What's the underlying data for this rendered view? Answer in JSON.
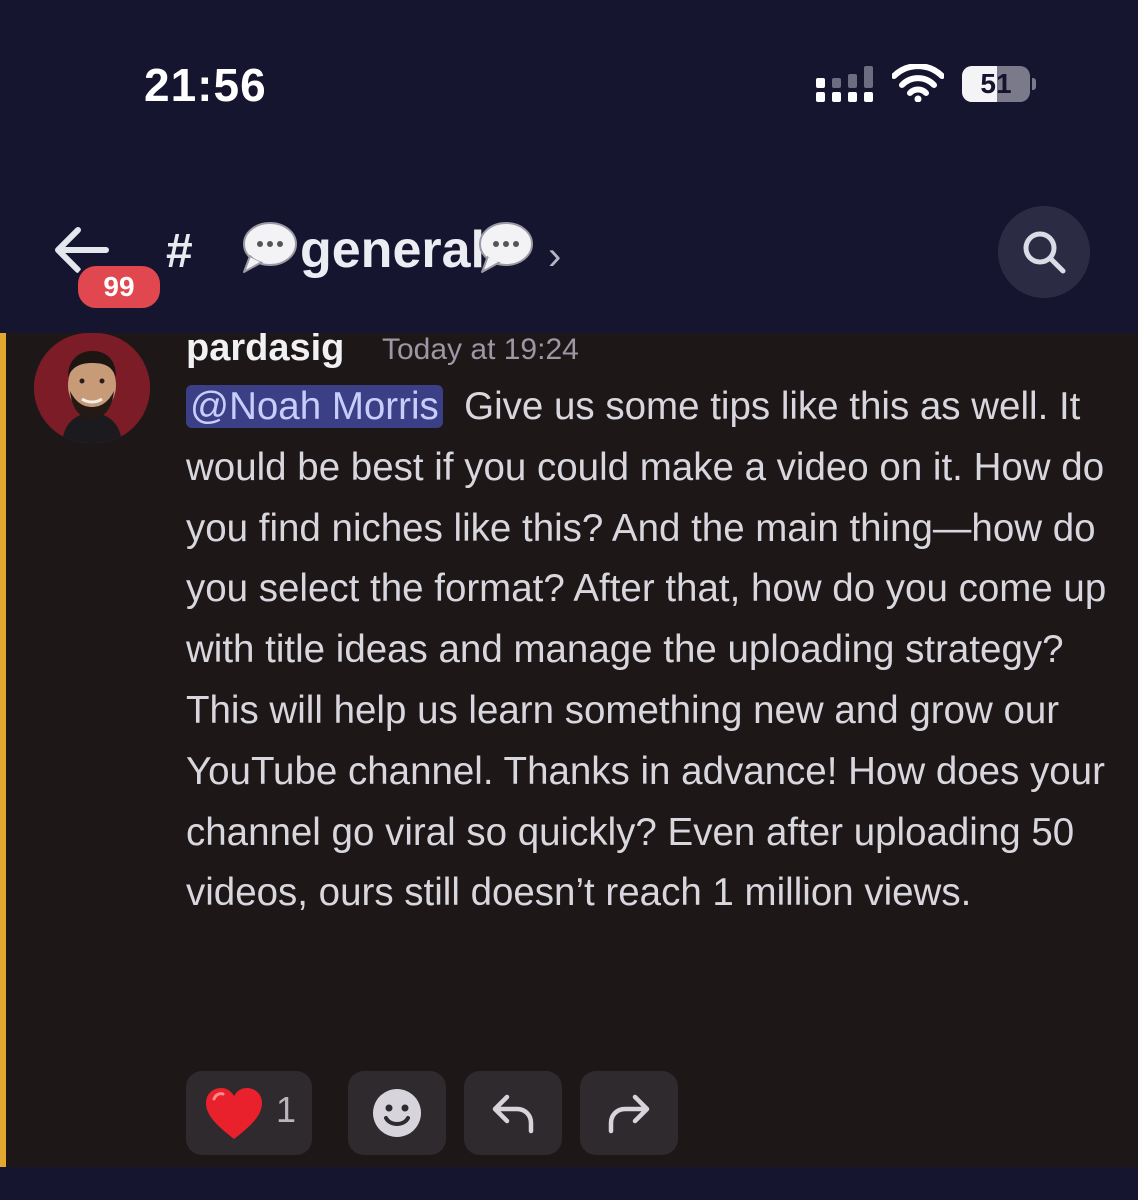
{
  "status_bar": {
    "time": "21:56",
    "battery_level": "51"
  },
  "header": {
    "unread_badge": "99",
    "channel_prefix": "#",
    "channel_name": "general",
    "chevron": "›"
  },
  "icons": {
    "back": "arrow-left-icon",
    "search": "search-icon",
    "channel_emoji": "speech-bubble-icon",
    "reaction_emoji": "heart-icon",
    "add_reaction": "smiley-icon",
    "reply": "reply-icon",
    "forward": "forward-icon"
  },
  "message": {
    "username": "pardasig",
    "timestamp": "Today at 19:24",
    "mention": "@Noah Morris",
    "body": "Give us some tips like this as well. It would be best if you could make a video on it. How do you find niches like this? And the main thing—how do you select the format? After that, how do you come up with title ideas and manage the uploading strategy? This will help us learn something new and grow our YouTube channel. Thanks in advance! How does your channel go viral so quickly? Even after uploading 50 videos, ours still doesn’t reach 1 million views."
  },
  "reactions": {
    "heart_count": "1"
  },
  "colors": {
    "header_bg": "#161530",
    "message_bg": "#1e1718",
    "highlight_bar": "#e3a82f",
    "badge": "#e0474e",
    "mention_bg": "#3b3f86",
    "mention_text": "#c9cdfb"
  }
}
